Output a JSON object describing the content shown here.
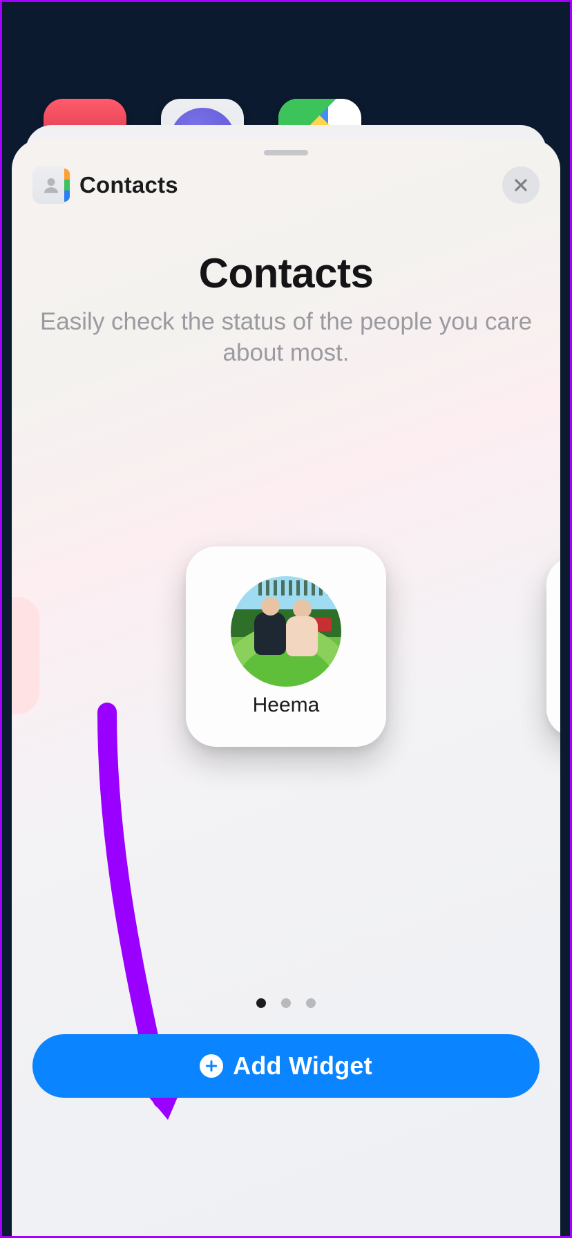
{
  "header": {
    "app_label": "Contacts"
  },
  "title": {
    "heading": "Contacts",
    "subheading": "Easily check the status of the people you care about most."
  },
  "widget_preview": {
    "contact_name": "Heema"
  },
  "pagination": {
    "count": 3,
    "active_index": 0
  },
  "add_button": {
    "label": "Add Widget"
  }
}
